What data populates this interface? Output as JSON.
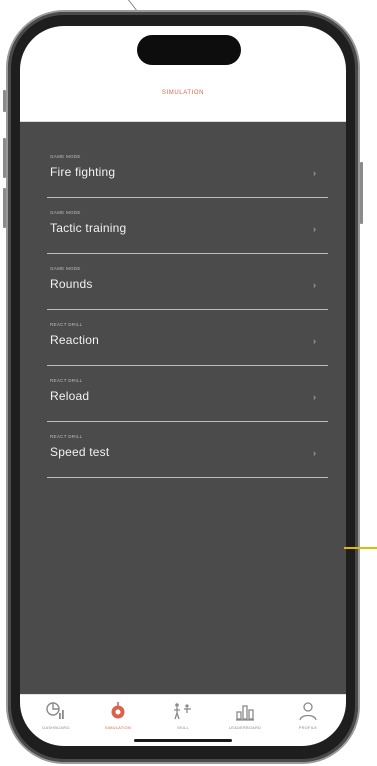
{
  "header": {
    "title": "SIMULATION"
  },
  "modes": [
    {
      "subtitle": "GAME MODE",
      "label": "Fire fighting"
    },
    {
      "subtitle": "GAME MODE",
      "label": "Tactic training"
    },
    {
      "subtitle": "GAME MODE",
      "label": "Rounds"
    },
    {
      "subtitle": "REACT DRILL",
      "label": "Reaction"
    },
    {
      "subtitle": "REACT DRILL",
      "label": "Reload"
    },
    {
      "subtitle": "REACT DRILL",
      "label": "Speed test"
    }
  ],
  "chevron": "›",
  "tabbar": {
    "active_index": 1,
    "tabs": [
      {
        "label": "DASHBOARD",
        "icon": "chart-icon"
      },
      {
        "label": "SIMULATION",
        "icon": "target-icon"
      },
      {
        "label": "SKILL",
        "icon": "skill-icon"
      },
      {
        "label": "LEADERBOARD",
        "icon": "leaderboard-icon"
      },
      {
        "label": "PROFILE",
        "icon": "profile-icon"
      }
    ]
  },
  "colors": {
    "accent": "#d9644d",
    "content_bg": "#4b4b4b",
    "annotation": "#e6b800"
  }
}
